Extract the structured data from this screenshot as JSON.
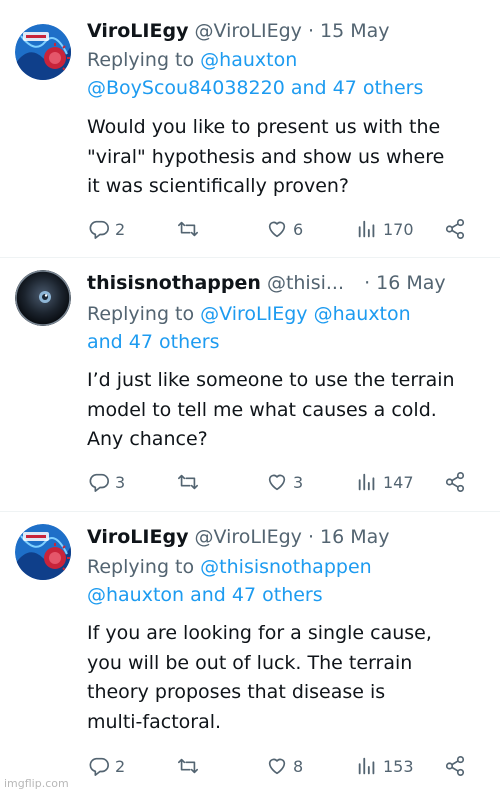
{
  "tweets": [
    {
      "name": "ViroLIEgy",
      "handle": "@ViroLIEgy",
      "sep": "·",
      "date": "15 May",
      "replying_prefix": "Replying to",
      "mentions_line1": "@hauxton",
      "mentions_line2": "@BoyScou84038220 and 47 others",
      "body": [
        "Would you like to present us with the",
        "\"viral\" hypothesis and show us where",
        "it was scientifically proven?"
      ],
      "replies": "2",
      "retweets": "",
      "likes": "6",
      "views": "170"
    },
    {
      "name": "thisisnothappen",
      "handle": "@thisi...",
      "sep": "·",
      "date": "16 May",
      "replying_prefix": "Replying to",
      "mentions_line1": "@ViroLIEgy @hauxton",
      "mentions_line2": "and 47 others",
      "body": [
        "I’d just like someone to use the terrain",
        "model to tell me what causes a cold.",
        "Any chance?"
      ],
      "replies": "3",
      "retweets": "",
      "likes": "3",
      "views": "147"
    },
    {
      "name": "ViroLIEgy",
      "handle": "@ViroLIEgy",
      "sep": "·",
      "date": "16 May",
      "replying_prefix": "Replying to",
      "mentions_line1": "@thisisnothappen",
      "mentions_line2": "@hauxton and 47 others",
      "body": [
        "If you are looking for a single cause,",
        "you will be out of luck. The terrain",
        "theory proposes that disease is",
        "multi-factoral."
      ],
      "replies": "2",
      "retweets": "",
      "likes": "8",
      "views": "153"
    }
  ],
  "watermark": "imgflip.com",
  "colors": {
    "accent": "#1d9bf0",
    "muted": "#536471",
    "text": "#0f1419"
  },
  "icons": [
    "reply-icon",
    "retweet-icon",
    "like-icon",
    "views-icon",
    "share-icon"
  ]
}
